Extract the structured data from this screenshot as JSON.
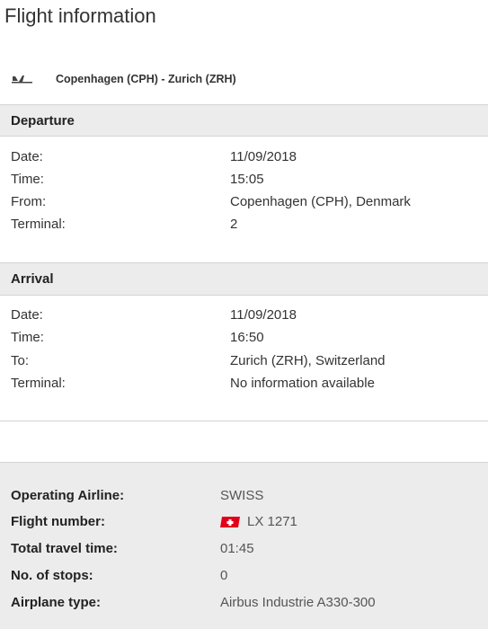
{
  "page": {
    "title": "Flight information"
  },
  "route": {
    "label": "Copenhagen (CPH) - Zurich (ZRH)",
    "icon": "airplane-icon"
  },
  "departure": {
    "header": "Departure",
    "rows": [
      {
        "label": "Date:",
        "value": "11/09/2018"
      },
      {
        "label": "Time:",
        "value": "15:05"
      },
      {
        "label": "From:",
        "value": "Copenhagen (CPH), Denmark"
      },
      {
        "label": "Terminal:",
        "value": "2"
      }
    ]
  },
  "arrival": {
    "header": "Arrival",
    "rows": [
      {
        "label": "Date:",
        "value": "11/09/2018"
      },
      {
        "label": "Time:",
        "value": "16:50"
      },
      {
        "label": "To:",
        "value": "Zurich (ZRH), Switzerland"
      },
      {
        "label": "Terminal:",
        "value": "No information available"
      }
    ]
  },
  "summary": {
    "rows": [
      {
        "label": "Operating Airline:",
        "value": "SWISS"
      },
      {
        "label": "Flight number:",
        "value": "LX 1271",
        "icon": "swiss-flag-icon"
      },
      {
        "label": "Total travel time:",
        "value": "01:45"
      },
      {
        "label": "No. of stops:",
        "value": "0"
      },
      {
        "label": "Airplane type:",
        "value": "Airbus Industrie A330-300"
      }
    ]
  },
  "colors": {
    "section_bg": "#ececec",
    "divider": "#d4d4d4",
    "flag_red": "#e2001a"
  }
}
